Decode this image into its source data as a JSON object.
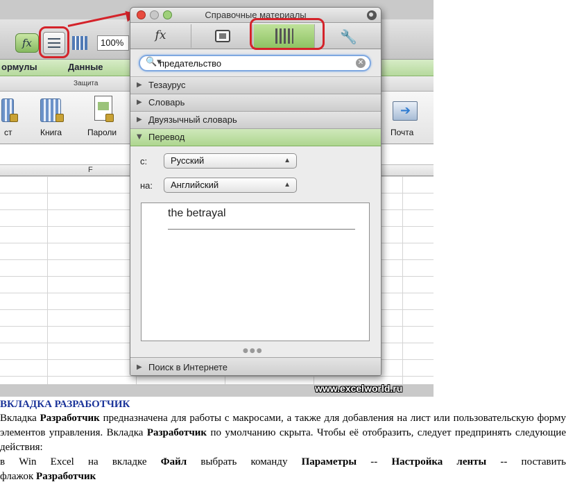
{
  "excel": {
    "fx_symbol": "fx",
    "zoom_value": "100%",
    "ribbon_tabs": [
      "ормулы",
      "Данные"
    ],
    "group_label": "Защита",
    "ribbon_buttons": [
      "ст",
      "Книга",
      "Пароли",
      "Почта"
    ],
    "column_header": "F"
  },
  "palette": {
    "title": "Справочные материалы",
    "tabs": [
      {
        "name": "fx",
        "icon": "function-icon"
      },
      {
        "name": "",
        "icon": "scrapbook-icon"
      },
      {
        "name": "",
        "icon": "reference-books-icon"
      },
      {
        "name": "",
        "icon": "wrench-icon"
      }
    ],
    "active_tab": 2,
    "search_value": "предательство",
    "sections": [
      "Тезаурус",
      "Словарь",
      "Двуязычный словарь",
      "Перевод"
    ],
    "from_label": "с:",
    "from_value": "Русский",
    "to_label": "на:",
    "to_value": "Английский",
    "translation": "the betrayal",
    "web_section": "Поиск в Интернете"
  },
  "watermark": "www.excelworld.ru",
  "callout_color": "#d4232a",
  "accent_color": "#9fd07a",
  "doc": {
    "heading": "ВКЛАДКА РАЗРАБОТЧИК",
    "p1_a": "Вкладка ",
    "p1_b": "Разработчик",
    "p1_c": " предназначена для работы с макросами, а также для добавления на лист или пользовательскую форму элементов управления. Вкладка ",
    "p1_d": "Разработчик",
    "p1_e": " по умолчанию скрыта. Чтобы её отобразить, следует предпринять следующие действия:",
    "p2_a": "в Win Excel на вкладке ",
    "p2_b": "Файл",
    "p2_c": " выбрать команду ",
    "p2_d": "Параметры",
    "p2_e": " -- ",
    "p2_f": "Настройка ленты",
    "p2_g": " -- поставить",
    "p3_a": "флажок ",
    "p3_b": "Разработчик"
  }
}
